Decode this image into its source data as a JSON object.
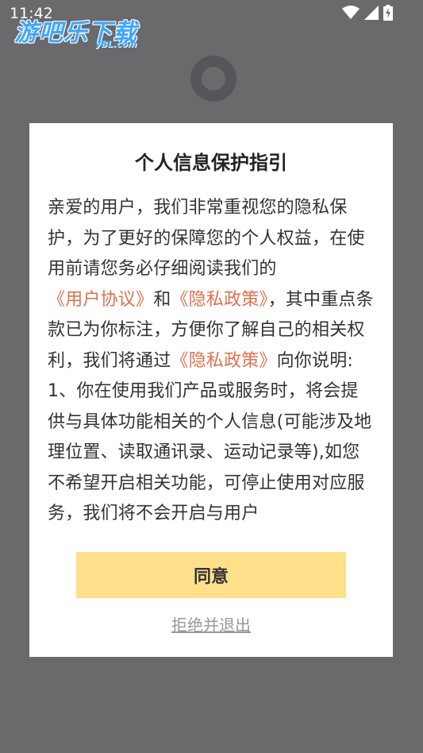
{
  "status_bar": {
    "time": "11:42",
    "icons": [
      "wifi-icon",
      "signal-icon",
      "battery-charging-icon"
    ]
  },
  "watermark": {
    "text": "游吧乐下载",
    "sub": "yBL.com"
  },
  "dialog": {
    "title": "个人信息保护指引",
    "body": [
      {
        "text": "亲爱的用户，我们非常重视您的隐私保护，为了更好的保障您的个人权益，在使用前请您务必仔细阅读我们的",
        "link": false
      },
      {
        "text": "《用户协议》",
        "link": true
      },
      {
        "text": "和",
        "link": false
      },
      {
        "text": "《隐私政策》",
        "link": true
      },
      {
        "text": "，其中重点条款已为你标注，方便你了解自己的相关权利，我们将通过",
        "link": false
      },
      {
        "text": "《隐私政策》",
        "link": true
      },
      {
        "text": "向你说明: 1、你在使用我们产品或服务时，将会提供与具体功能相关的个人信息(可能涉及地理位置、读取通讯录、运动记录等),如您不希望开启相关功能，可停止使用对应服务，我们将不会开启与用户",
        "link": false
      }
    ],
    "agree_label": "同意",
    "reject_label": "拒绝并退出"
  },
  "colors": {
    "overlay": "#6a6a6c",
    "link": "#e0704f",
    "agree_button": "#ffe08a",
    "reject_text": "#999999"
  }
}
